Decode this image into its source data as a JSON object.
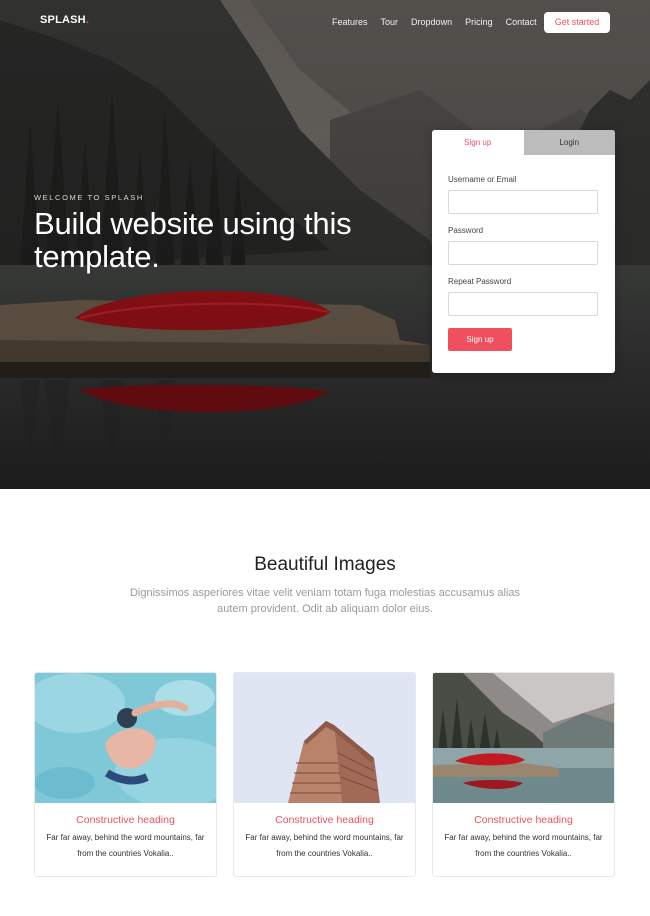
{
  "brand": {
    "name": "SPLASH",
    "dot": "."
  },
  "nav": {
    "items": [
      "Features",
      "Tour",
      "Dropdown",
      "Pricing",
      "Contact"
    ]
  },
  "header": {
    "cta_label": "Get started"
  },
  "hero": {
    "kicker": "Welcome to Splash",
    "title": "Build website using this template."
  },
  "form": {
    "tabs": [
      "Sign up",
      "Login"
    ],
    "fields": [
      {
        "label": "Username or Email",
        "value": ""
      },
      {
        "label": "Password",
        "value": ""
      },
      {
        "label": "Repeat Password",
        "value": ""
      }
    ],
    "submit_label": "Sign up"
  },
  "section": {
    "title": "Beautiful Images",
    "description": "Dignissimos asperiores vitae velit veniam totam fuga molestias accusamus alias autem provident. Odit ab aliquam dolor eius."
  },
  "cards": [
    {
      "heading": "Constructive heading",
      "text": "Far far away, behind the word mountains, far from the countries Vokalia..",
      "image": "swimmer-photo"
    },
    {
      "heading": "Constructive heading",
      "text": "Far far away, behind the word mountains, far from the countries Vokalia..",
      "image": "building-photo"
    },
    {
      "heading": "Constructive heading",
      "text": "Far far away, behind the word mountains, far from the countries Vokalia..",
      "image": "lake-canoe-photo"
    }
  ],
  "colors": {
    "accent": "#f0505d",
    "tab_inactive": "#bcbcbc",
    "muted_text": "#9a9a9a"
  }
}
